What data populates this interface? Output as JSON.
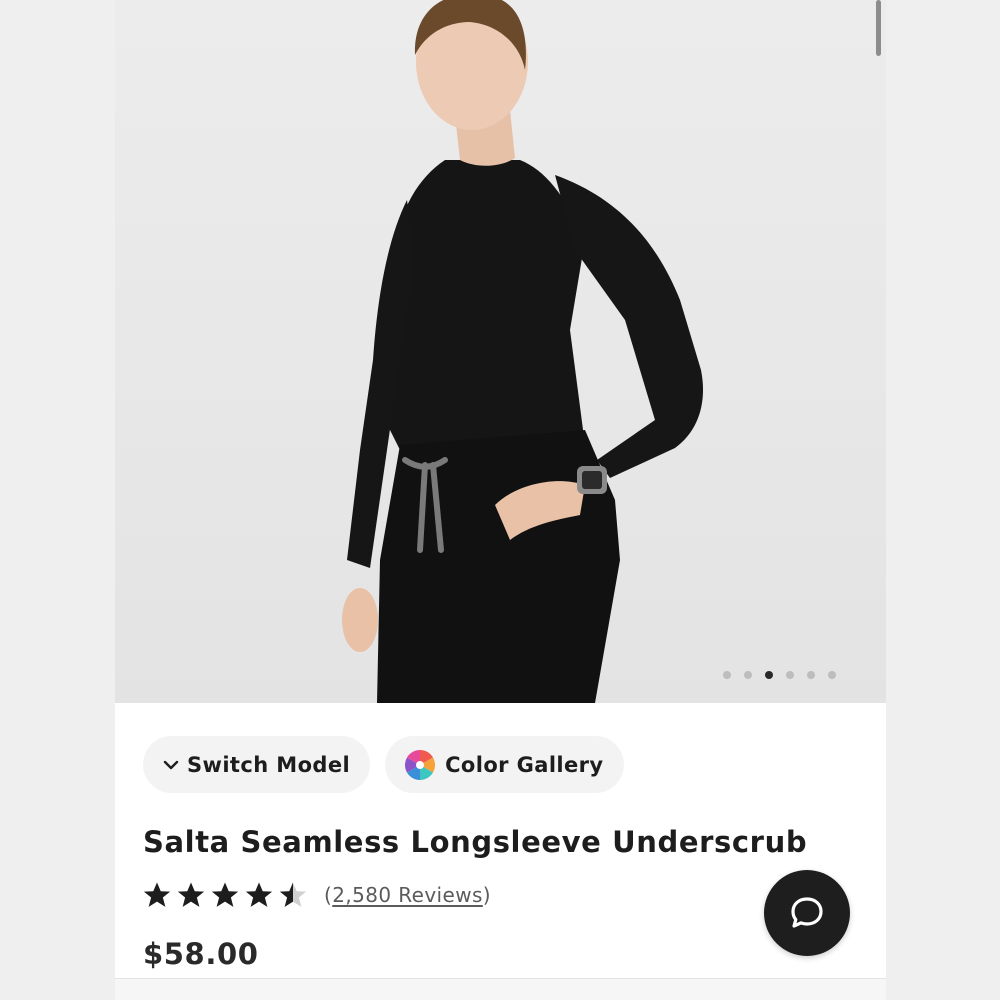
{
  "product": {
    "title": "Salta Seamless Longsleeve Underscrub",
    "price": "$58.00",
    "rating": 4.5,
    "reviews_open": "(",
    "reviews_label": "2,580 Reviews",
    "reviews_close": ")"
  },
  "chips": {
    "switch_model": "Switch Model",
    "color_gallery": "Color Gallery"
  },
  "gallery": {
    "dot_count": 6,
    "active_index": 2
  },
  "icons": {
    "switch_model": "chevron-down-icon",
    "color_gallery": "color-wheel-icon",
    "chat": "chat-bubble-icon"
  },
  "colors": {
    "text": "#1d1d1d",
    "chip_bg": "#f3f3f3",
    "chat_bg": "#1e1e1e",
    "active_dot": "#2a2a2a"
  }
}
